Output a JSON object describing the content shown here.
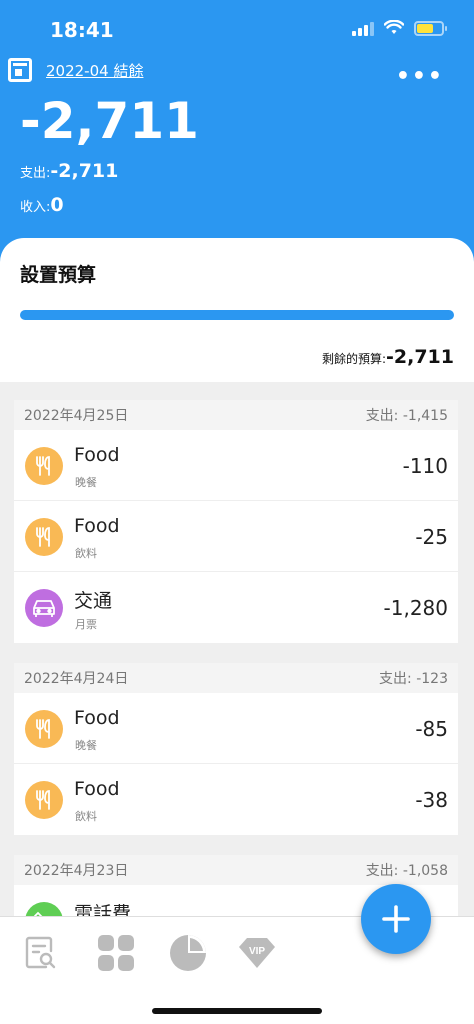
{
  "status": {
    "time": "18:41"
  },
  "header": {
    "period": "2022-04 結餘",
    "balance": "-2,711",
    "expense_label": "支出:",
    "expense_value": "-2,711",
    "income_label": "收入:",
    "income_value": "0"
  },
  "budget": {
    "title": "設置預算",
    "remaining_label": "剩餘的預算:",
    "remaining_value": "-2,711",
    "progress": 1.0
  },
  "days": [
    {
      "date": "2022年4月25日",
      "total": "支出: -1,415",
      "transactions": [
        {
          "category": "Food",
          "note": "晚餐",
          "amount": "-110",
          "icon": "utensils-icon"
        },
        {
          "category": "Food",
          "note": "飲料",
          "amount": "-25",
          "icon": "utensils-icon"
        },
        {
          "category": "交通",
          "note": "月票",
          "amount": "-1,280",
          "icon": "car-icon"
        }
      ]
    },
    {
      "date": "2022年4月24日",
      "total": "支出: -123",
      "transactions": [
        {
          "category": "Food",
          "note": "晚餐",
          "amount": "-85",
          "icon": "utensils-icon"
        },
        {
          "category": "Food",
          "note": "飲料",
          "amount": "-38",
          "icon": "utensils-icon"
        }
      ]
    },
    {
      "date": "2022年4月23日",
      "total": "支出: -1,058",
      "transactions": [
        {
          "category": "電話費",
          "icon": "phone-icon"
        }
      ]
    }
  ],
  "nav": {
    "items": [
      "records-icon",
      "grid-icon",
      "pie-chart-icon",
      "vip-icon"
    ],
    "vip_label": "VIP"
  },
  "colors": {
    "primary": "#2b97f1",
    "food": "#f9b955",
    "transport": "#bf6ee0",
    "phone": "#5fce54"
  }
}
